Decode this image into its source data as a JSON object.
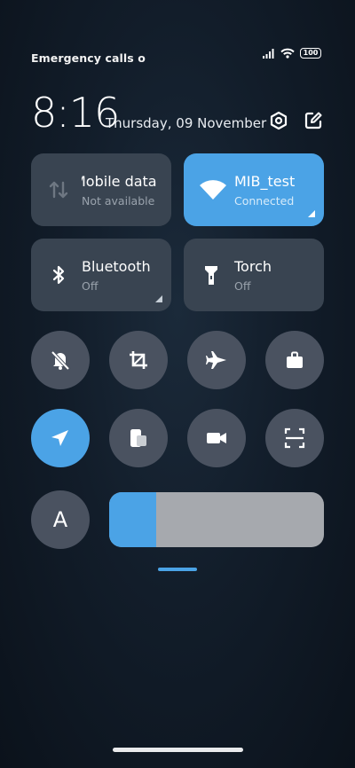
{
  "status_bar": {
    "carrier_text": "Emergency calls o",
    "battery_level": "100",
    "icons": [
      "signal-icon",
      "wifi-icon",
      "battery-icon"
    ]
  },
  "header": {
    "time": "8:16",
    "date": "Thursday, 09 November",
    "icons": [
      "settings-icon",
      "edit-icon"
    ]
  },
  "tiles": [
    {
      "title": "Mobile data",
      "subtitle": "Not available",
      "icon": "mobile-data-icon",
      "active": false
    },
    {
      "title": "MIB_test",
      "subtitle": "Connected",
      "icon": "wifi-icon",
      "active": true
    },
    {
      "title": "Bluetooth",
      "subtitle": "Off",
      "icon": "bluetooth-icon",
      "active": false
    },
    {
      "title": "Torch",
      "subtitle": "Off",
      "icon": "torch-icon",
      "active": false
    }
  ],
  "toggles_row1": [
    {
      "icon": "mute-bell-icon",
      "active": false
    },
    {
      "icon": "crop-icon",
      "active": false
    },
    {
      "icon": "airplane-icon",
      "active": false
    },
    {
      "icon": "briefcase-icon",
      "active": false
    }
  ],
  "toggles_row2": [
    {
      "icon": "location-icon",
      "active": true
    },
    {
      "icon": "screen-mirror-icon",
      "active": false
    },
    {
      "icon": "video-camera-icon",
      "active": false
    },
    {
      "icon": "scan-icon",
      "active": false
    }
  ],
  "auto_brightness": {
    "label": "A"
  },
  "brightness": {
    "level": 0.22
  },
  "colors": {
    "accent": "#4ba3e6",
    "tile": "#394451",
    "circle": "#4a5260",
    "slider_track": "#a6a9ae"
  }
}
